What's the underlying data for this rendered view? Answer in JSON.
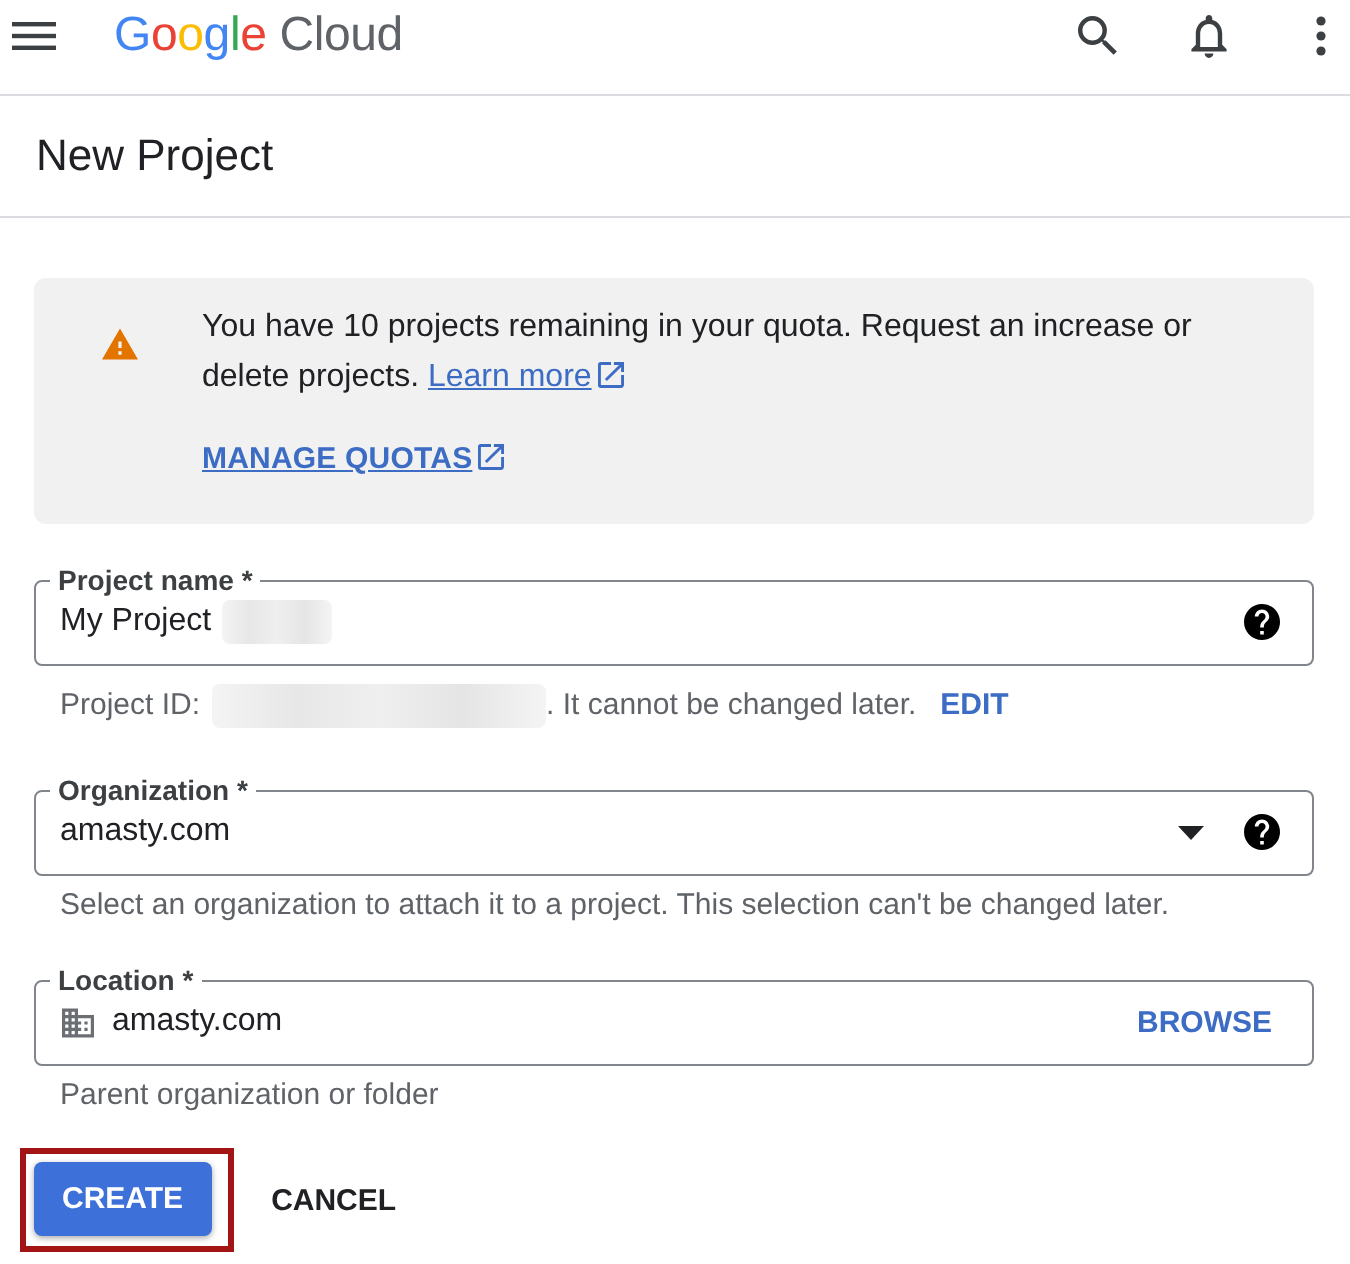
{
  "app_bar": {
    "logo": {
      "brand": "Google",
      "product": "Cloud"
    }
  },
  "page_title": "New Project",
  "quota_alert": {
    "message": "You have 10 projects remaining in your quota. Request an increase or delete projects.",
    "link": "Learn more",
    "action": "MANAGE QUOTAS"
  },
  "fields": [
    {
      "kind": "text",
      "label": "Project name *",
      "value": "My Project",
      "value_redacted": true,
      "help": true,
      "hint": {
        "text": "Project ID:",
        "redacted": true,
        "suffix": ". It cannot be changed later.",
        "action": "EDIT"
      }
    },
    {
      "kind": "select",
      "label": "Organization *",
      "value": "amasty.com",
      "value_redacted": false,
      "help": true,
      "hint": {
        "text": "Select an organization to attach it to a project. This selection can't be changed later.",
        "redacted": false
      }
    },
    {
      "kind": "location",
      "label": "Location *",
      "value": "amasty.com",
      "value_redacted": false,
      "help": false,
      "action": "BROWSE",
      "hint": {
        "text": "Parent organization or folder",
        "redacted": false
      }
    }
  ],
  "buttons": [
    {
      "kind": "primary",
      "label": "CREATE",
      "highlighted": true
    },
    {
      "kind": "text",
      "label": "CANCEL",
      "highlighted": false
    }
  ]
}
